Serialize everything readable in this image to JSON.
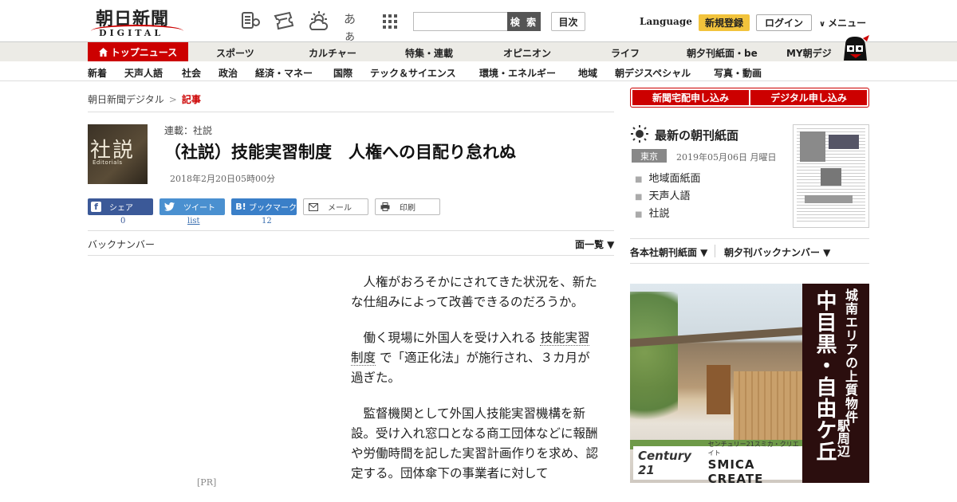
{
  "header": {
    "logo_jp": "朝日新聞",
    "logo_en": "DIGITAL",
    "search_button": "検 索",
    "toc_button": "目次",
    "language": "Language",
    "register": "新規登録",
    "login": "ログイン",
    "menu": "メニュー",
    "icons": [
      "paper-list-icon",
      "ticket-icon",
      "weather-icon",
      "font-size-icon",
      "grid-icon"
    ],
    "font_icon_text": "あぁ"
  },
  "nav_primary": {
    "home": "トップニュース",
    "items": [
      "スポーツ",
      "カルチャー",
      "特集・連載",
      "オピニオン",
      "ライフ",
      "朝夕刊紙面・be",
      "MY朝デジ"
    ]
  },
  "nav_secondary": {
    "items": [
      "新着",
      "天声人語",
      "社会",
      "政治",
      "経済・マネー",
      "国際",
      "テック＆サイエンス",
      "環境・エネルギー",
      "地域",
      "朝デジスペシャル",
      "写真・動画"
    ]
  },
  "breadcrumb": {
    "home": "朝日新聞デジタル",
    "separator": ">",
    "current": "記事"
  },
  "article": {
    "badge_kanji": "社説",
    "badge_en": "Editorials",
    "series": "連載：社説",
    "headline": "（社説）技能実習制度　人権への目配り怠れぬ",
    "date": "2018年2月20日05時00分",
    "share": [
      {
        "label": "シェア",
        "count": "0",
        "icon": "f"
      },
      {
        "label": "ツイート",
        "count": "list",
        "icon": "t"
      },
      {
        "label": "ブックマーク",
        "count": "12",
        "icon": "B!"
      },
      {
        "label": "メール",
        "count": "",
        "icon": "mail"
      },
      {
        "label": "印刷",
        "count": "",
        "icon": "print"
      }
    ],
    "back_number": "バックナンバー",
    "page_list": "面一覧 ▼",
    "pr": "[PR]",
    "p1": "人権がおろそかにされてきた状況を、新たな仕組みによって改善できるのだろうか。",
    "p2_pre": "働く現場に外国人を受け入れる",
    "p2_kw": "技能実習制度",
    "p2_post": "で「適正化法」が施行され、３カ月が過ぎた。",
    "p3": "監督機関として外国人技能実習機構を新設。受け入れ窓口となる商工団体などに報酬や労働時間を記した実習計画作りを求め、認定する。団体傘下の事業者に対して"
  },
  "sidebar": {
    "apply_home": "新聞宅配申し込み",
    "apply_digital": "デジタル申し込み",
    "latest_title": "最新の朝刊紙面",
    "edition": "東京",
    "paper_date": "2019年05月06日 月曜日",
    "links": [
      "地域面紙面",
      "天声人語",
      "社説"
    ],
    "subnav_1": "各本社朝刊紙面 ▼",
    "subnav_2": "朝夕刊バックナンバー ▼"
  },
  "ad": {
    "line1": "城南エリアの上質物件",
    "line2": "中目黒・自由ケ丘",
    "line3": "駅周辺",
    "brand_mark": "Century 21",
    "brand_jp": "センチュリー21スミカ・クリエイト",
    "brand_en": "SMICA CREATE"
  },
  "colors": {
    "brand_red": "#cc0000",
    "facebook": "#3b5998",
    "twitter": "#4a90d0",
    "hatena": "#3a7fc8",
    "register_yellow": "#f2c33c"
  }
}
